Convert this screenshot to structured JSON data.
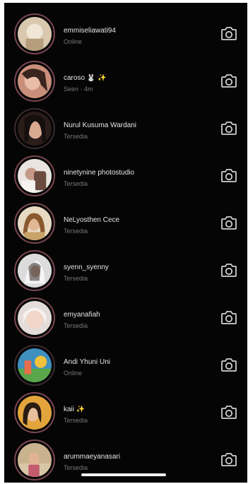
{
  "colors": {
    "background": "#050505",
    "name_text": "#e6e6e6",
    "status_text": "#777777",
    "avatar_ring": "#7a4750",
    "camera_icon": "#cfcfcf"
  },
  "conversations": [
    {
      "name": "emmiseliawati94",
      "status": "Online",
      "icon": "camera-icon"
    },
    {
      "name": "caroso 🐰 ✨",
      "status": "Seen · 4m",
      "icon": "camera-icon"
    },
    {
      "name": "Nurul Kusuma Wardani",
      "status": "Tersedia",
      "icon": "camera-icon"
    },
    {
      "name": "ninetynine photostudio",
      "status": "Tersedia",
      "icon": "camera-icon"
    },
    {
      "name": "NeLyosthen Cece",
      "status": "Tersedia",
      "icon": "camera-icon"
    },
    {
      "name": "syenn_syenny",
      "status": "Tersedia",
      "icon": "camera-icon"
    },
    {
      "name": "emyanafiah",
      "status": "Tersedia",
      "icon": "camera-icon"
    },
    {
      "name": "Andi Yhuni Uni",
      "status": "Online",
      "icon": "camera-icon"
    },
    {
      "name": "kaii ✨",
      "status": "Tersedia",
      "icon": "camera-icon"
    },
    {
      "name": "arummaeyanasari",
      "status": "Tersedia",
      "icon": "camera-icon"
    }
  ]
}
